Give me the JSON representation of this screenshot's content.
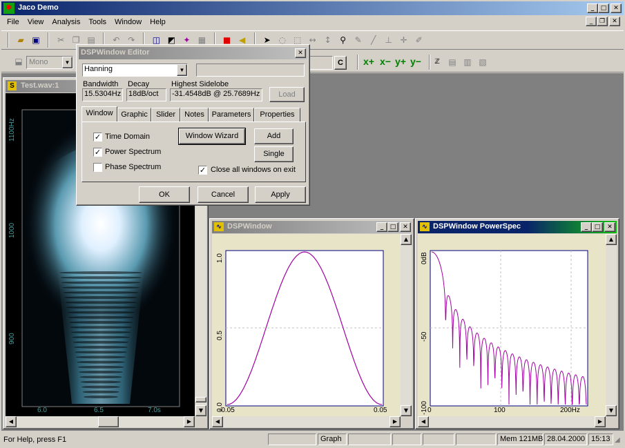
{
  "app": {
    "title": "Jaco Demo"
  },
  "menu": [
    "File",
    "View",
    "Analysis",
    "Tools",
    "Window",
    "Help"
  ],
  "toolbar2": {
    "mono_select": "Mono",
    "c_button": "C",
    "tools": [
      "x+",
      "x−",
      "y+",
      "y−"
    ]
  },
  "dialog": {
    "title": "DSPWindow Editor",
    "window_select": "Hanning",
    "name_field": "",
    "bandwidth_label": "Bandwidth",
    "bandwidth_value": "15.5304Hz",
    "decay_label": "Decay",
    "decay_value": "18dB/oct",
    "sidelobe_label": "Highest Sidelobe",
    "sidelobe_value": "-31.4548dB @ 25.7689Hz",
    "load_label": "Load",
    "tabs": [
      "Window",
      "Graphic",
      "Slider",
      "Notes",
      "Parameters",
      "Properties"
    ],
    "active_tab": "Window",
    "checks": [
      {
        "label": "Time Domain",
        "checked": true
      },
      {
        "label": "Power Spectrum",
        "checked": true
      },
      {
        "label": "Phase Spectrum",
        "checked": false
      }
    ],
    "window_wizard_label": "Window Wizard",
    "add_label": "Add",
    "single_label": "Single",
    "close_all_label": "Close all windows on exit",
    "close_all_checked": true,
    "ok_label": "OK",
    "cancel_label": "Cancel",
    "apply_label": "Apply"
  },
  "spectrogram": {
    "title": "Test.wav:1",
    "y_ticks": [
      "1100Hz",
      "1000",
      "900"
    ],
    "x_ticks": [
      "6.0",
      "6.5",
      "7.0s"
    ]
  },
  "dspwindow": {
    "title": "DSPWindow",
    "y_ticks": [
      "1.0",
      "0.5",
      "0.0"
    ],
    "x_ticks": [
      "-0.05",
      "0.05"
    ]
  },
  "powerspec": {
    "title": "DSPWindow PowerSpec",
    "y_ticks": [
      "0dB",
      "-50",
      "-100"
    ],
    "x_ticks": [
      "0",
      "100",
      "200Hz"
    ]
  },
  "status": {
    "help": "For Help, press F1",
    "mode": "Graph",
    "mem": "Mem 121MB",
    "date": "28.04.2000",
    "time": "15:13"
  },
  "colors": {
    "curve": "#a000a0",
    "plot_bg": "#e8e4c8",
    "title_active": "#0a246a"
  }
}
